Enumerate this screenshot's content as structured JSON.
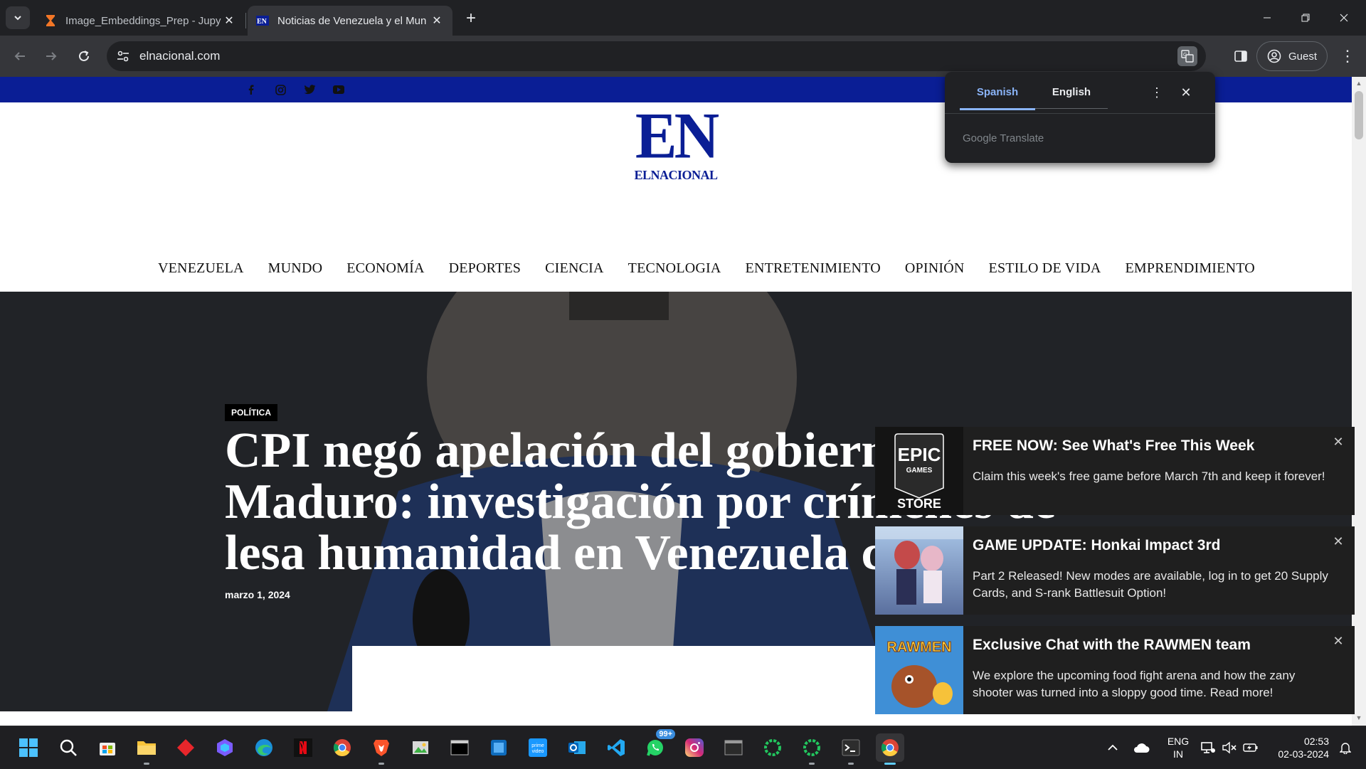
{
  "browser": {
    "tabs": [
      {
        "title": "Image_Embeddings_Prep - Jupy",
        "favicon": "hourglass-icon",
        "active": false
      },
      {
        "title": "Noticias de Venezuela y el Mun",
        "favicon": "el-nacional-favicon",
        "active": true
      }
    ],
    "url": "elnacional.com",
    "profile_label": "Guest"
  },
  "translate_popup": {
    "source_lang": "Spanish",
    "target_lang": "English",
    "brand_google": "Google",
    "brand_translate": "Translate"
  },
  "site": {
    "logo_big": "EN",
    "logo_small": "ELNACIONAL",
    "social_icons": [
      "facebook-icon",
      "instagram-icon",
      "twitter-icon",
      "youtube-icon"
    ],
    "nav": [
      "VENEZUELA",
      "MUNDO",
      "ECONOMÍA",
      "DEPORTES",
      "CIENCIA",
      "TECNOLOGIA",
      "ENTRETENIMIENTO",
      "OPINIÓN",
      "ESTILO DE VIDA",
      "EMPRENDIMIENTO"
    ],
    "hero": {
      "category": "POLÍTICA",
      "headline_line1": "CPI negó apelación del gobierno",
      "headline_line2": "Maduro: investigación por crímenes de",
      "headline_line3": "lesa humanidad en Venezuela c",
      "date": "marzo 1, 2024"
    }
  },
  "notifications": [
    {
      "title": "FREE NOW: See What's Free This Week",
      "body": "Claim this week's free game before March 7th and keep it forever!",
      "thumb_line1": "EPIC",
      "thumb_line2": "GAMES",
      "thumb_line3": "STORE"
    },
    {
      "title": "GAME UPDATE: Honkai Impact 3rd",
      "body": "Part 2 Released! New modes are available, log in to get 20 Supply Cards, and S-rank Battlesuit Option!"
    },
    {
      "title": "Exclusive Chat with the RAWMEN team",
      "body": "We explore the upcoming food fight arena and how the zany shooter was turned into a sloppy good time. Read more!",
      "thumb_text": "RAWMEN"
    }
  ],
  "taskbar": {
    "whatsapp_badge": "99+",
    "lang_line1": "ENG",
    "lang_line2": "IN",
    "time": "02:53",
    "date": "02-03-2024"
  },
  "colors": {
    "brand_blue": "#0a1e95",
    "translate_accent": "#8ab4f8"
  }
}
